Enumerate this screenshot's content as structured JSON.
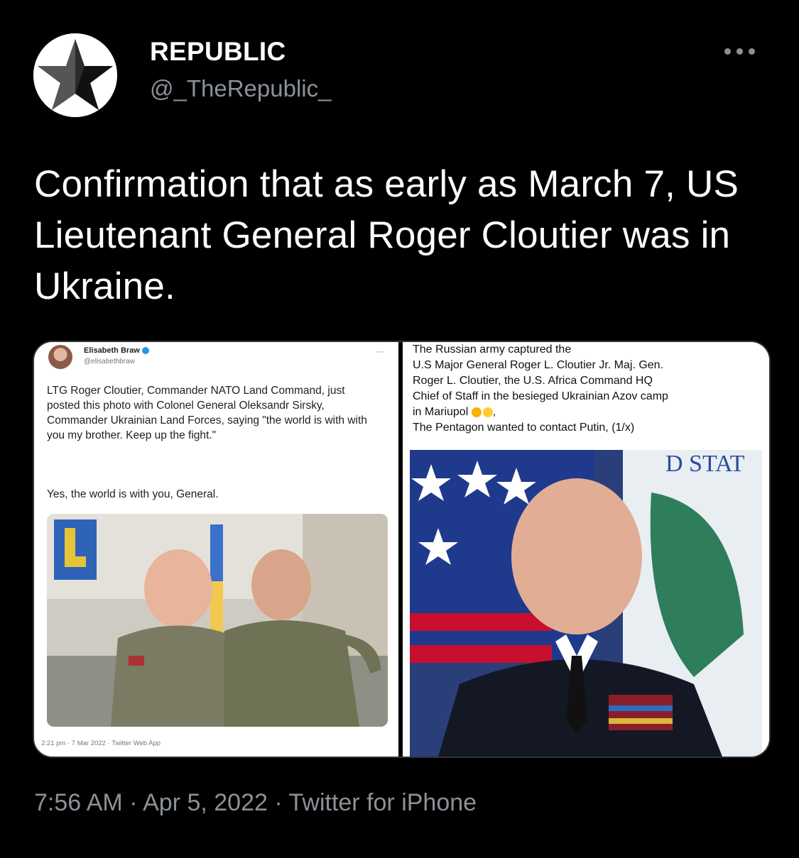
{
  "author": {
    "display_name": "REPUBLIC",
    "handle": "@_TheRepublic_",
    "avatar_icon": "star-icon"
  },
  "tweet": {
    "text": "Confirmation that as early as March 7, US Lieutenant General Roger Cloutier was in Ukraine.",
    "time": "7:56 AM",
    "date": "Apr 5, 2022",
    "source": "Twitter for iPhone",
    "separator": " · "
  },
  "media": {
    "left_panel": {
      "name": "Elisabeth Braw",
      "handle": "@elisabethbraw",
      "more": "···",
      "text": "LTG Roger Cloutier, Commander NATO Land Command, just posted this photo with Colonel General Oleksandr Sirsky, Commander Ukrainian Land Forces, saying \"the world is with with you my brother. Keep up the fight.\"",
      "text2": "Yes, the world is with you, General.",
      "footer": "2:21 pm · 7 Mar 2022 · Twitter Web App"
    },
    "right_panel": {
      "line1": "The Russian army captured the",
      "line2": "U.S Major General Roger L. Cloutier Jr. Maj. Gen.",
      "line3": "Roger L. Cloutier, the U.S. Africa Command HQ",
      "line4": "Chief of Staff in the besieged Ukrainian Azov camp",
      "line5": "in Mariupol",
      "line5_end": ",",
      "line6": "The Pentagon wanted to contact Putin, (1/x)",
      "seal_text": "D STAT"
    }
  },
  "colors": {
    "background": "#000000",
    "secondary_text": "#8b9197",
    "border": "#2f3336"
  }
}
